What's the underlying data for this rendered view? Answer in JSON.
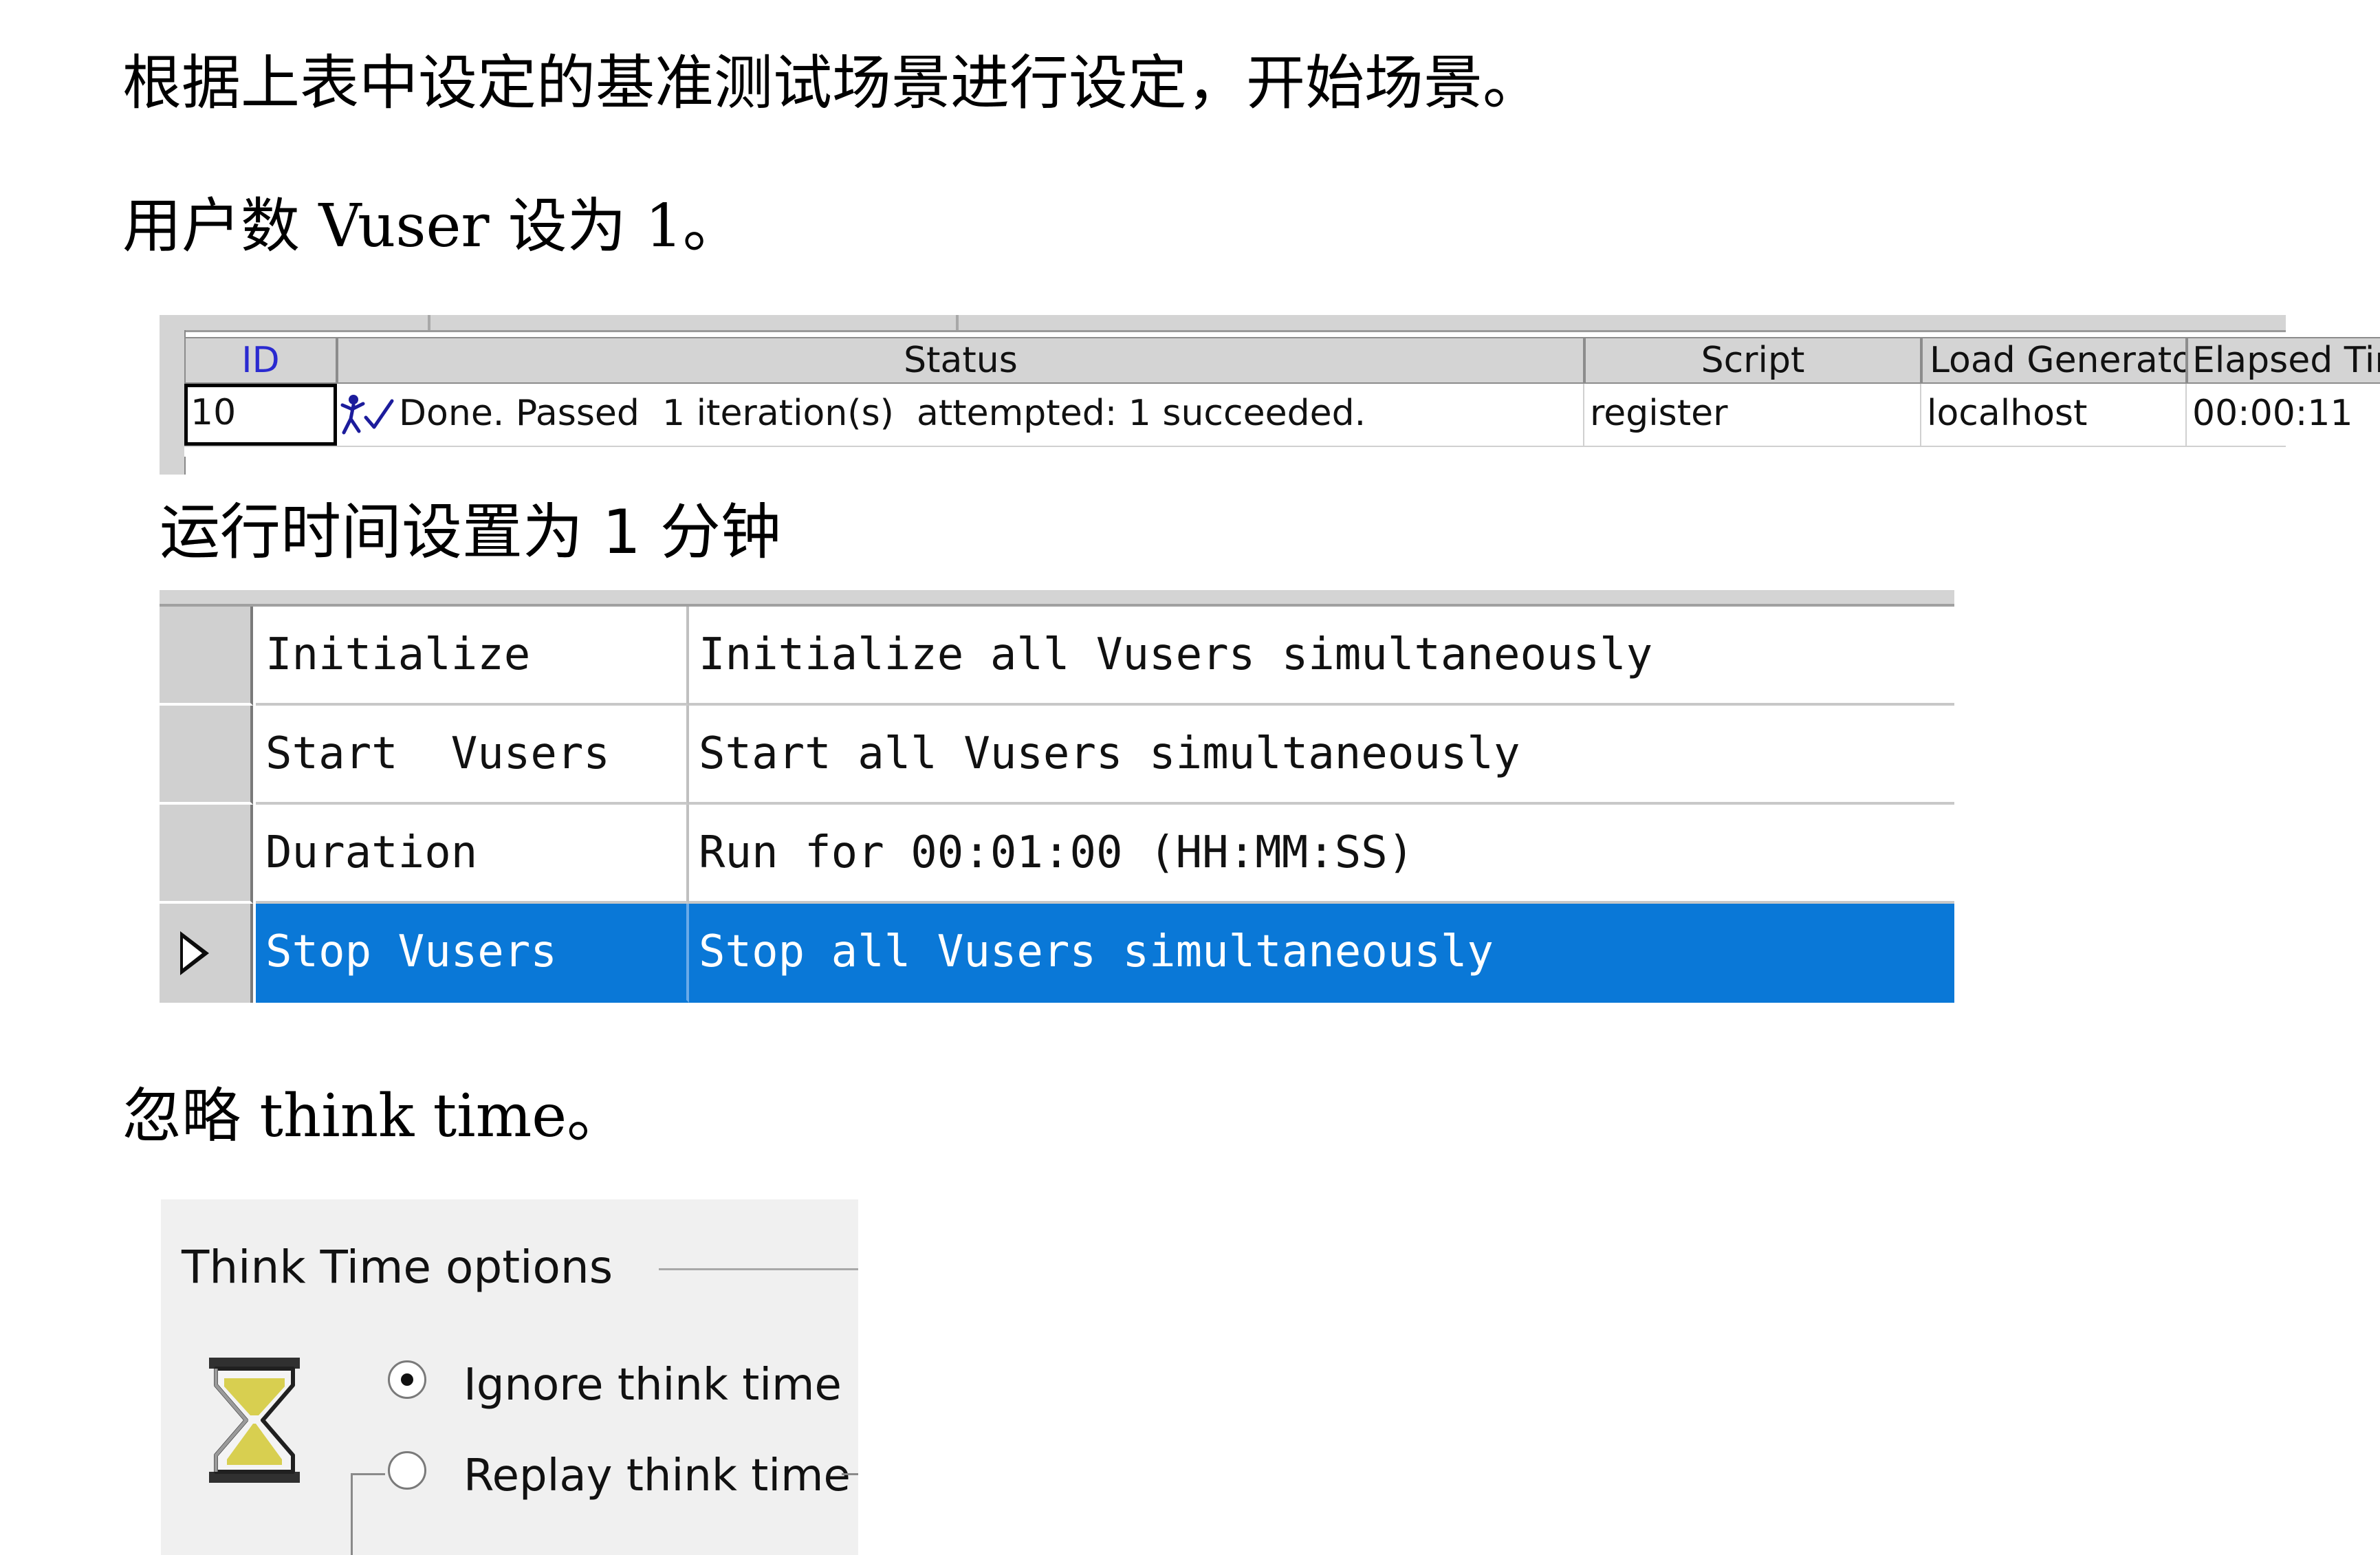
{
  "paragraphs": {
    "p1": "根据上表中设定的基准测试场景进行设定，开始场景。",
    "p2": "用户数 Vuser 设为 1。",
    "p3": "运行时间设置为 1 分钟",
    "p4": "忽略 think time。"
  },
  "vuser_grid": {
    "headers": {
      "id": "ID",
      "status": "Status",
      "script": "Script",
      "load_generator": "Load Generator",
      "elapsed_time": "Elapsed Time"
    },
    "row": {
      "id": "10",
      "status_icon": "vuser-running-man-icon",
      "status": "Done. Passed  1 iteration(s)  attempted: 1 succeeded.",
      "script": "register",
      "load_generator": "localhost",
      "elapsed_time": "00:00:11"
    }
  },
  "schedule": {
    "rows": [
      {
        "action": "Initialize",
        "description": "Initialize all Vusers simultaneously",
        "selected": false
      },
      {
        "action": "Start  Vusers",
        "description": "Start all Vusers simultaneously",
        "selected": false
      },
      {
        "action": "Duration",
        "description": "Run for 00:01:00 (HH:MM:SS)",
        "selected": false
      },
      {
        "action": "Stop Vusers",
        "description": "Stop all Vusers simultaneously",
        "selected": true
      }
    ],
    "selection_color": "#0a78d7"
  },
  "think_time": {
    "title": "Think Time options",
    "icon": "hourglass-icon",
    "options": [
      {
        "label": "Ignore think time",
        "checked": true
      },
      {
        "label": "Replay think time",
        "checked": false
      }
    ]
  }
}
